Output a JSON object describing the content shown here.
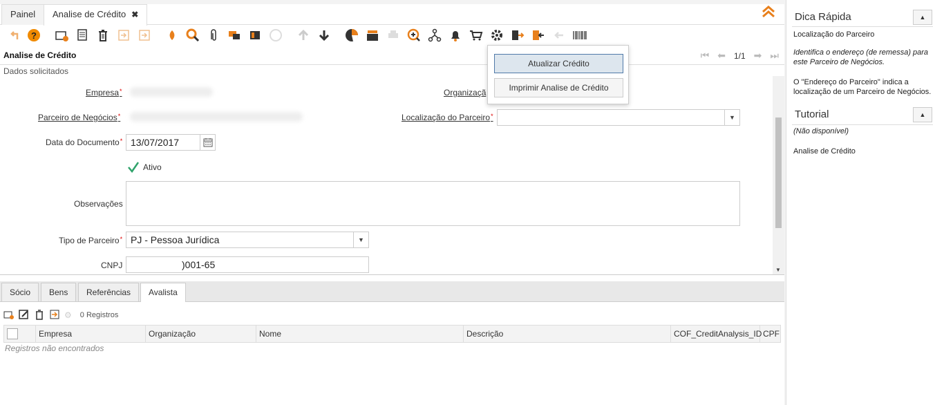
{
  "tabs": [
    {
      "label": "Painel"
    },
    {
      "label": "Analise de Crédito",
      "close": "✖"
    }
  ],
  "form": {
    "title": "Analise de Crédito",
    "record_position": "1/1",
    "section": "Dados solicitados",
    "labels": {
      "empresa": "Empresa",
      "organizacao": "Organizaçã",
      "parceiro": "Parceiro de Negócios",
      "localizacao": "Localização do Parceiro",
      "data_documento": "Data do Documento",
      "ativo": "Ativo",
      "observacoes": "Observações",
      "tipo_parceiro": "Tipo de Parceiro",
      "cnpj": "CNPJ"
    },
    "values": {
      "data_documento": "13/07/2017",
      "tipo_parceiro": "PJ - Pessoa Jurídica",
      "cnpj": ")001-65"
    }
  },
  "popup": {
    "items": [
      "Atualizar Crédito",
      "Imprimir Analise de Crédito"
    ]
  },
  "subtabs": [
    "Sócio",
    "Bens",
    "Referências",
    "Avalista"
  ],
  "subgrid": {
    "count": "0 Registros",
    "columns": [
      "Empresa",
      "Organização",
      "Nome",
      "Descrição",
      "COF_CreditAnalysis_ID",
      "CPF"
    ],
    "empty": "Registros não encontrados"
  },
  "right_panel": {
    "quick_tip_title": "Dica Rápida",
    "quick_tip_field": "Localização do Parceiro",
    "quick_tip_desc": "Identifica o endereço (de remessa) para este Parceiro de Negócios.",
    "quick_tip_help": "O \"Endereço do Parceiro\" indica a localização de um Parceiro de Negócios.",
    "tutorial_title": "Tutorial",
    "tutorial_status": "(Não disponível)",
    "tutorial_window": "Analise de Crédito"
  },
  "colors": {
    "accent": "#e8801c",
    "popup_hover": "#4f79a8"
  }
}
